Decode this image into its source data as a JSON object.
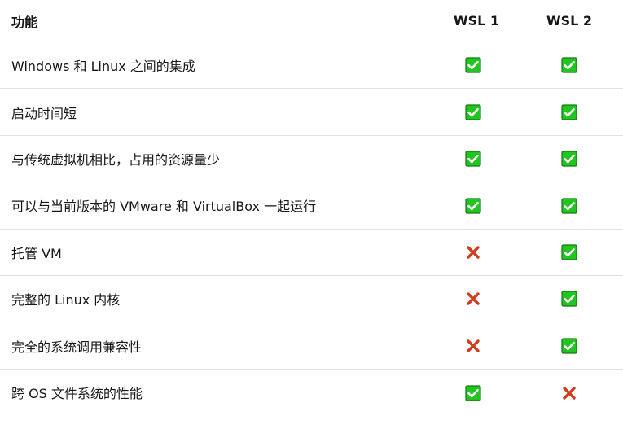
{
  "header": {
    "feature": "功能",
    "wsl1": "WSL 1",
    "wsl2": "WSL 2"
  },
  "rows": [
    {
      "feature": "Windows 和 Linux 之间的集成",
      "wsl1": "check",
      "wsl2": "check"
    },
    {
      "feature": "启动时间短",
      "wsl1": "check",
      "wsl2": "check"
    },
    {
      "feature": "与传统虚拟机相比，占用的资源量少",
      "wsl1": "check",
      "wsl2": "check"
    },
    {
      "feature": "可以与当前版本的 VMware 和 VirtualBox 一起运行",
      "wsl1": "check",
      "wsl2": "check"
    },
    {
      "feature": "托管 VM",
      "wsl1": "cross",
      "wsl2": "check"
    },
    {
      "feature": "完整的 Linux 内核",
      "wsl1": "cross",
      "wsl2": "check"
    },
    {
      "feature": "完全的系统调用兼容性",
      "wsl1": "cross",
      "wsl2": "check"
    },
    {
      "feature": "跨 OS 文件系统的性能",
      "wsl1": "check",
      "wsl2": "cross"
    }
  ],
  "icons": {
    "check": "check-mark-icon",
    "cross": "cross-mark-icon"
  },
  "colors": {
    "check_fill": "#22c41f",
    "check_border": "#137a14",
    "cross": "#d13d1c"
  }
}
